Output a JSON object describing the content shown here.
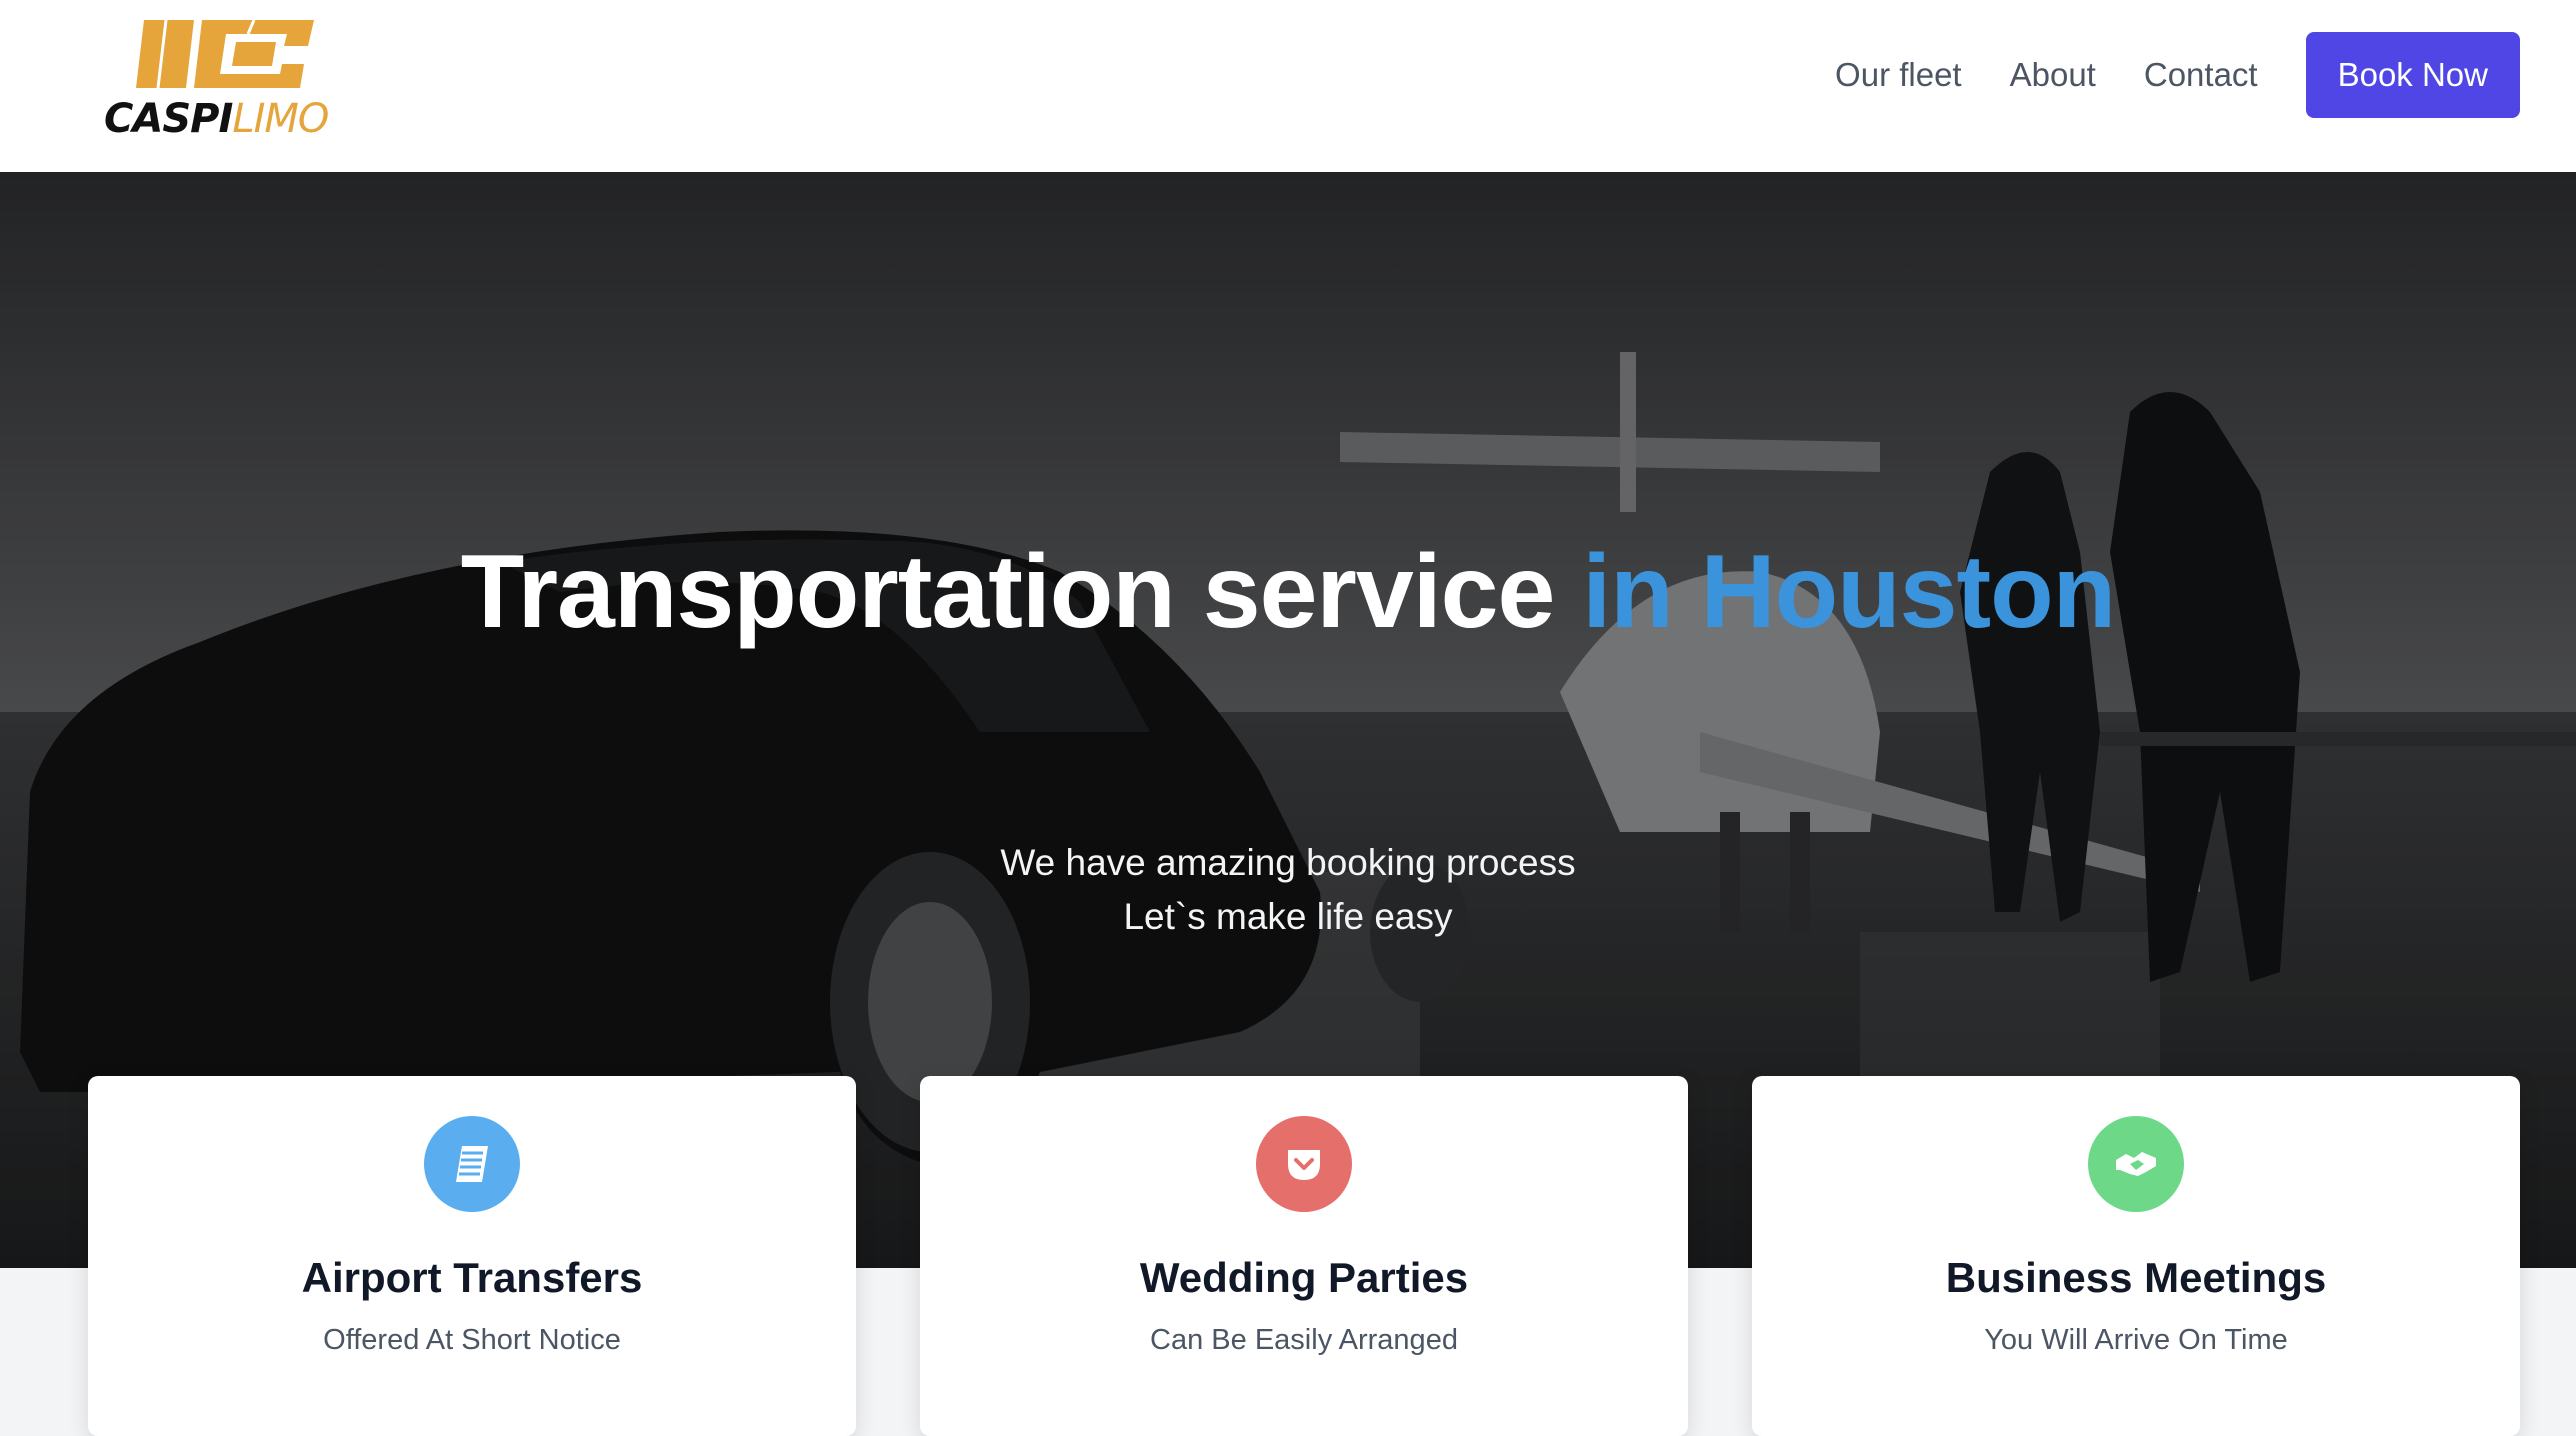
{
  "brand": {
    "name_part1": "CASPI",
    "name_part2": "LIMO",
    "primary_color": "#e5a53a"
  },
  "nav": {
    "links": [
      {
        "label": "Our fleet"
      },
      {
        "label": "About"
      },
      {
        "label": "Contact"
      }
    ],
    "cta_label": "Book Now",
    "cta_color": "#4f46e5"
  },
  "hero": {
    "title_main": "Transportation service",
    "title_accent": "in Houston",
    "accent_color": "#3b93db",
    "subtitle_line1": "We have amazing booking process",
    "subtitle_line2": "Let`s make life easy"
  },
  "services": [
    {
      "icon": "document-icon",
      "icon_color": "#5aaeef",
      "title": "Airport Transfers",
      "subtitle": "Offered At Short Notice"
    },
    {
      "icon": "heart-pocket-icon",
      "icon_color": "#e56f6b",
      "title": "Wedding Parties",
      "subtitle": "Can Be Easily Arranged"
    },
    {
      "icon": "handshake-icon",
      "icon_color": "#6dd888",
      "title": "Business Meetings",
      "subtitle": "You Will Arrive On Time"
    }
  ]
}
